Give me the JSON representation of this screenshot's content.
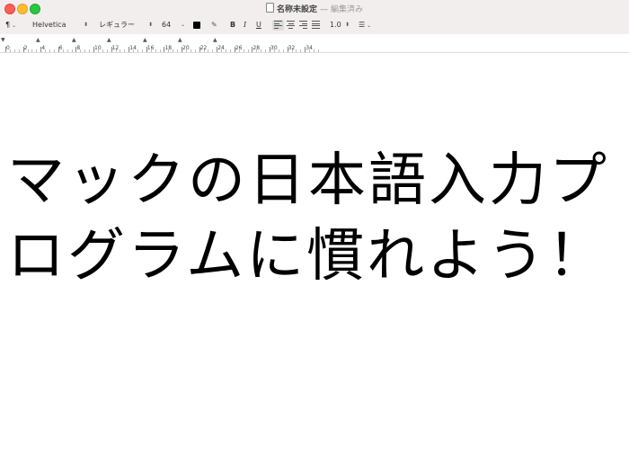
{
  "window": {
    "title": "名称未設定",
    "separator": "—",
    "status": "編集済み"
  },
  "toolbar": {
    "paragraph_symbol": "¶",
    "font_family": "Helvetica",
    "font_style": "レギュラー",
    "font_size": "64",
    "text_color": "#000000",
    "bold_label": "B",
    "italic_label": "I",
    "underline_label": "U",
    "line_spacing": "1.0"
  },
  "ruler": {
    "labels": [
      "0",
      "2",
      "4",
      "6",
      "8",
      "10",
      "12",
      "14",
      "16",
      "18",
      "20",
      "22",
      "24",
      "26",
      "28",
      "30",
      "32",
      "34"
    ]
  },
  "document": {
    "line1": "マックの日本語入力プ",
    "line2": "ログラムに慣れよう！"
  }
}
